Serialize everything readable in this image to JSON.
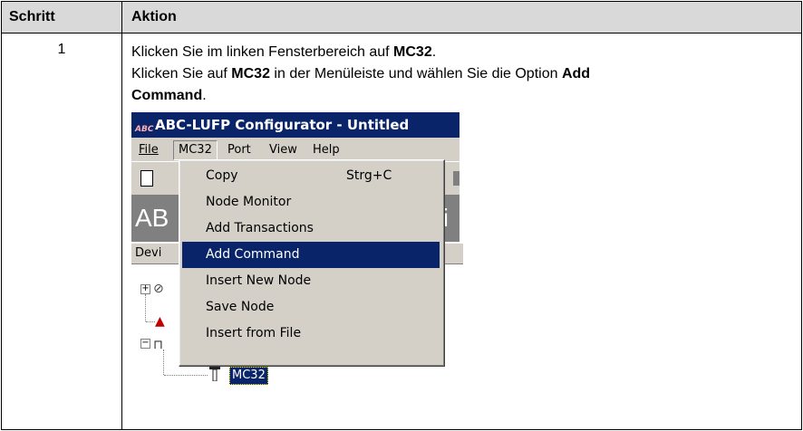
{
  "table": {
    "header_step": "Schritt",
    "header_action": "Aktion"
  },
  "row": {
    "step": "1",
    "line1_a": "Klicken Sie im linken Fensterbereich auf ",
    "line1_b": "MC32",
    "line1_c": ".",
    "line2_a": "Klicken Sie auf ",
    "line2_b": "MC32",
    "line2_c": " in der Menüleiste und wählen Sie die Option ",
    "line2_d": "Add",
    "line3_a": "Command",
    "line3_b": "."
  },
  "screenshot": {
    "title": "ABC-LUFP Configurator - Untitled",
    "app_icon_text": "ABC",
    "menu": [
      "File",
      "MC32",
      "Port",
      "View",
      "Help"
    ],
    "banner_left": "AB",
    "banner_right": "ti",
    "dev_header": "Devi",
    "dropdown": [
      {
        "label": "Copy",
        "shortcut": "Strg+C"
      },
      {
        "label": "Node Monitor",
        "shortcut": ""
      },
      {
        "label": "Add Transactions",
        "shortcut": ""
      },
      {
        "label": "Add Command",
        "shortcut": "",
        "highlighted": true
      },
      {
        "label": "Insert New Node",
        "shortcut": ""
      },
      {
        "label": "Save Node",
        "shortcut": ""
      },
      {
        "label": "Insert from File",
        "shortcut": ""
      }
    ],
    "selected_node": "MC32",
    "colors": {
      "titlebar": "#0a246a",
      "highlight": "#0a246a",
      "menu_bg": "#d4d0c8"
    }
  }
}
